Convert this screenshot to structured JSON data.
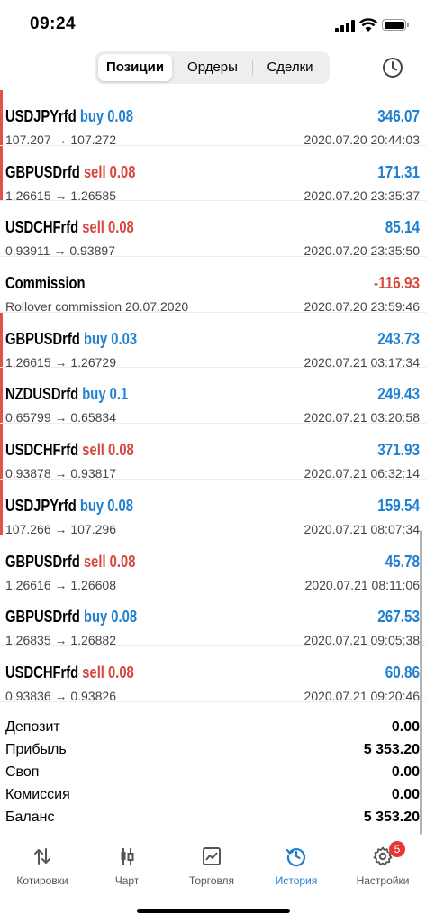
{
  "status": {
    "time": "09:24"
  },
  "segments": [
    "Позиции",
    "Ордеры",
    "Сделки"
  ],
  "rows": [
    {
      "symbol": "USDJPYrfd",
      "side": "buy",
      "volume": "0.08",
      "prices": "107.207 → 107.272",
      "profit": "346.07",
      "datetime": "2020.07.20 20:44:03",
      "mark": true
    },
    {
      "symbol": "GBPUSDrfd",
      "side": "sell",
      "volume": "0.08",
      "prices": "1.26615 → 1.26585",
      "profit": "171.31",
      "datetime": "2020.07.20 23:35:37",
      "mark": true
    },
    {
      "symbol": "USDCHFrfd",
      "side": "sell",
      "volume": "0.08",
      "prices": "0.93911 → 0.93897",
      "profit": "85.14",
      "datetime": "2020.07.20 23:35:50",
      "mark": false
    },
    {
      "symbol": "Commission",
      "side": "",
      "volume": "",
      "prices": "Rollover commission 20.07.2020",
      "profit": "-116.93",
      "datetime": "2020.07.20 23:59:46",
      "mark": false
    },
    {
      "symbol": "GBPUSDrfd",
      "side": "buy",
      "volume": "0.03",
      "prices": "1.26615 → 1.26729",
      "profit": "243.73",
      "datetime": "2020.07.21 03:17:34",
      "mark": true
    },
    {
      "symbol": "NZDUSDrfd",
      "side": "buy",
      "volume": "0.1",
      "prices": "0.65799 → 0.65834",
      "profit": "249.43",
      "datetime": "2020.07.21 03:20:58",
      "mark": true
    },
    {
      "symbol": "USDCHFrfd",
      "side": "sell",
      "volume": "0.08",
      "prices": "0.93878 → 0.93817",
      "profit": "371.93",
      "datetime": "2020.07.21 06:32:14",
      "mark": true
    },
    {
      "symbol": "USDJPYrfd",
      "side": "buy",
      "volume": "0.08",
      "prices": "107.266 → 107.296",
      "profit": "159.54",
      "datetime": "2020.07.21 08:07:34",
      "mark": true
    },
    {
      "symbol": "GBPUSDrfd",
      "side": "sell",
      "volume": "0.08",
      "prices": "1.26616 → 1.26608",
      "profit": "45.78",
      "datetime": "2020.07.21 08:11:06",
      "mark": false
    },
    {
      "symbol": "GBPUSDrfd",
      "side": "buy",
      "volume": "0.08",
      "prices": "1.26835 → 1.26882",
      "profit": "267.53",
      "datetime": "2020.07.21 09:05:38",
      "mark": false
    },
    {
      "symbol": "USDCHFrfd",
      "side": "sell",
      "volume": "0.08",
      "prices": "0.93836 → 0.93826",
      "profit": "60.86",
      "datetime": "2020.07.21 09:20:46",
      "mark": false
    }
  ],
  "summary": [
    {
      "label": "Депозит",
      "value": "0.00"
    },
    {
      "label": "Прибыль",
      "value": "5 353.20"
    },
    {
      "label": "Своп",
      "value": "0.00"
    },
    {
      "label": "Комиссия",
      "value": "0.00"
    },
    {
      "label": "Баланс",
      "value": "5 353.20"
    }
  ],
  "tabs": [
    {
      "label": "Котировки",
      "icon": "quotes-arrows-icon"
    },
    {
      "label": "Чарт",
      "icon": "candlestick-chart-icon"
    },
    {
      "label": "Торговля",
      "icon": "trade-chart-icon"
    },
    {
      "label": "История",
      "icon": "history-clock-icon"
    },
    {
      "label": "Настройки",
      "icon": "settings-gear-icon"
    }
  ],
  "settings_badge": "5",
  "colors": {
    "buy": "#1f7fd0",
    "sell": "#d7473c",
    "accent": "#1f7fd0",
    "badge": "#e53935"
  }
}
